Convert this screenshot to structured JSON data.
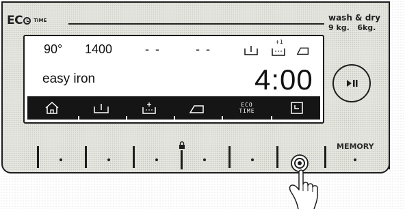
{
  "brand": {
    "eco": "EC",
    "time_label": "TIME"
  },
  "capacity": {
    "title": "wash & dry",
    "values": "9 kg.   6kg."
  },
  "display": {
    "temperature": "90°",
    "spin": "1400",
    "placeholder_1": "- -",
    "placeholder_2": "- -",
    "program": "easy iron",
    "time": "4:00",
    "option_icons": [
      "spin-option-icon",
      "extra-rinse-icon",
      "easy-iron-icon"
    ],
    "extra_rinse_badge": "+1"
  },
  "nav_bar": {
    "items": [
      {
        "name": "home-icon"
      },
      {
        "name": "spin-icon"
      },
      {
        "name": "rinse-icon"
      },
      {
        "name": "iron-icon"
      },
      {
        "name": "eco-time",
        "label": "ECO TIME"
      },
      {
        "name": "delay-timer-icon"
      }
    ]
  },
  "controls": {
    "play_pause": "play-pause-icon",
    "memory_label": "MEMORY",
    "lock": "lock-icon",
    "hold_button": "touch-hold-button"
  },
  "colors": {
    "panel": "#e5e6df",
    "ink": "#1d1d1d",
    "screen": "#ffffff",
    "nav_bar": "#151515"
  }
}
